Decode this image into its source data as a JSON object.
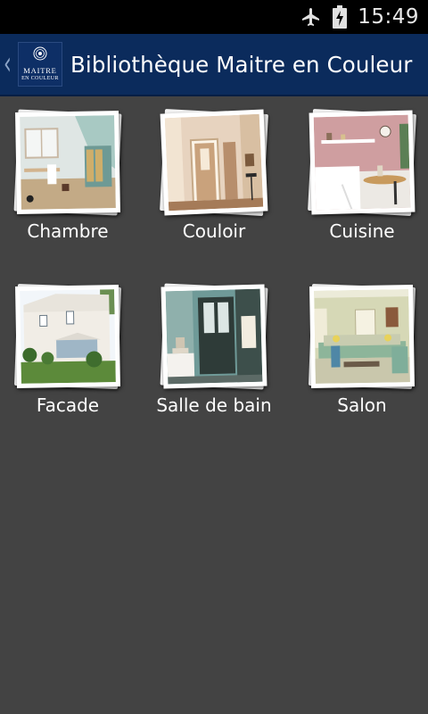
{
  "status_bar": {
    "time": "15:49",
    "icons": [
      "airplane-mode-icon",
      "battery-charging-icon"
    ]
  },
  "action_bar": {
    "title": "Bibliothèque Maitre en Couleur",
    "logo": {
      "line1": "MAITRE",
      "line2": "EN COULEUR"
    },
    "up_icon": "chevron-left-icon"
  },
  "rooms": [
    {
      "label": "Chambre"
    },
    {
      "label": "Couloir"
    },
    {
      "label": "Cuisine"
    },
    {
      "label": "Facade"
    },
    {
      "label": "Salle de bain"
    },
    {
      "label": "Salon"
    }
  ],
  "colors": {
    "background": "#434343",
    "status_bar": "#000000",
    "action_bar": "#0b2b5c",
    "text": "#ffffff"
  }
}
